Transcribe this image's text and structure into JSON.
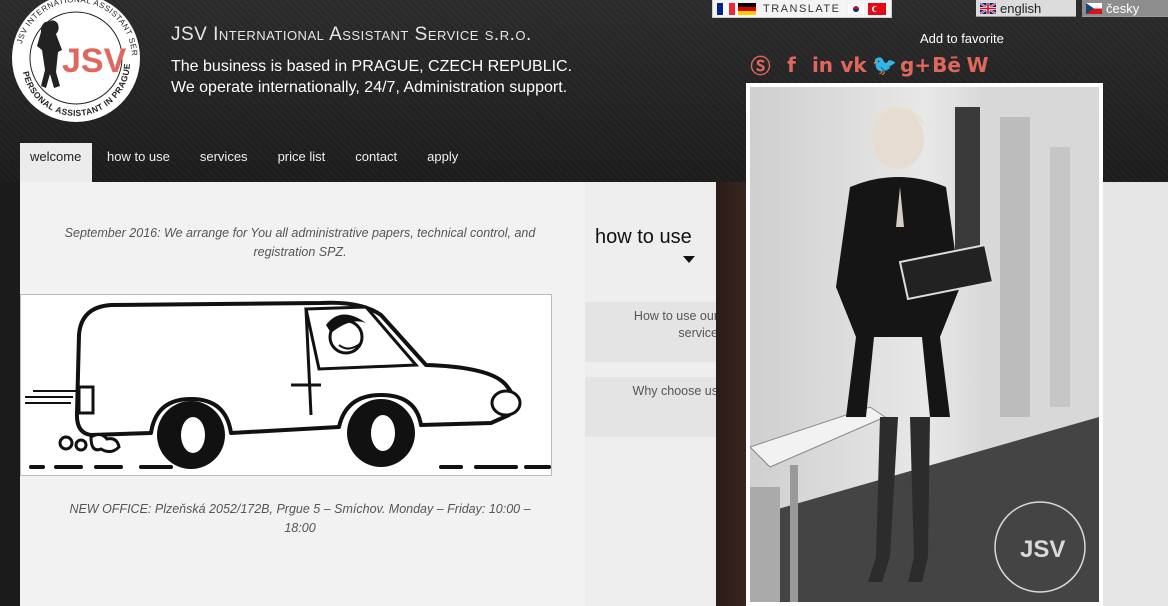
{
  "header": {
    "logo_text": "JSV",
    "logo_ring_text": "JSV INTERNATIONAL ASSISTANT SERVICE · PERSONAL ASSISTANT IN PRAGUE",
    "company_title_parts": [
      "JSV I",
      "NTERNATIONAL",
      " A",
      "SSISTANT",
      " S",
      "ERVICE",
      " s.r.o."
    ],
    "tagline_1": "The business is based in PRAGUE, CZECH REPUBLIC.",
    "tagline_2": "We operate internationally, 24/7, Administration support."
  },
  "translate": {
    "label": "TRANSLATE",
    "flags": [
      "france-flag",
      "germany-flag",
      "korea-flag",
      "turkey-flag"
    ]
  },
  "languages": [
    {
      "label": "english",
      "flag": "uk-flag"
    },
    {
      "label": "česky",
      "flag": "czech-flag"
    }
  ],
  "favorite": {
    "label": "Add to favorite"
  },
  "social": [
    {
      "name": "skype-icon",
      "glyph": "Ⓢ"
    },
    {
      "name": "facebook-icon",
      "glyph": "f"
    },
    {
      "name": "linkedin-icon",
      "glyph": "in"
    },
    {
      "name": "vk-icon",
      "glyph": "vk"
    },
    {
      "name": "twitter-icon",
      "glyph": "🐦"
    },
    {
      "name": "googleplus-icon",
      "glyph": "g+"
    },
    {
      "name": "behance-icon",
      "glyph": "Bē"
    },
    {
      "name": "wordpress-icon",
      "glyph": "W"
    }
  ],
  "nav": [
    {
      "label": "welcome",
      "active": true
    },
    {
      "label": "how to use"
    },
    {
      "label": "services"
    },
    {
      "label": "price list"
    },
    {
      "label": "contact"
    },
    {
      "label": "apply"
    }
  ],
  "content": {
    "news_1": "September 2016: We arrange for You all administrative papers, technical control, and registration SPZ.",
    "news_2": "NEW OFFICE: Plzeňská 2052/172B, Prgue 5 – Smíchov. Monday – Friday: 10:00 – 18:00"
  },
  "side": {
    "title": "how to use",
    "links": [
      "How to use our service",
      "Why choose us"
    ]
  },
  "colors": {
    "accent": "#e0675e",
    "header_bg": "#1e1e1e",
    "content_bg": "#f2f2f2"
  }
}
